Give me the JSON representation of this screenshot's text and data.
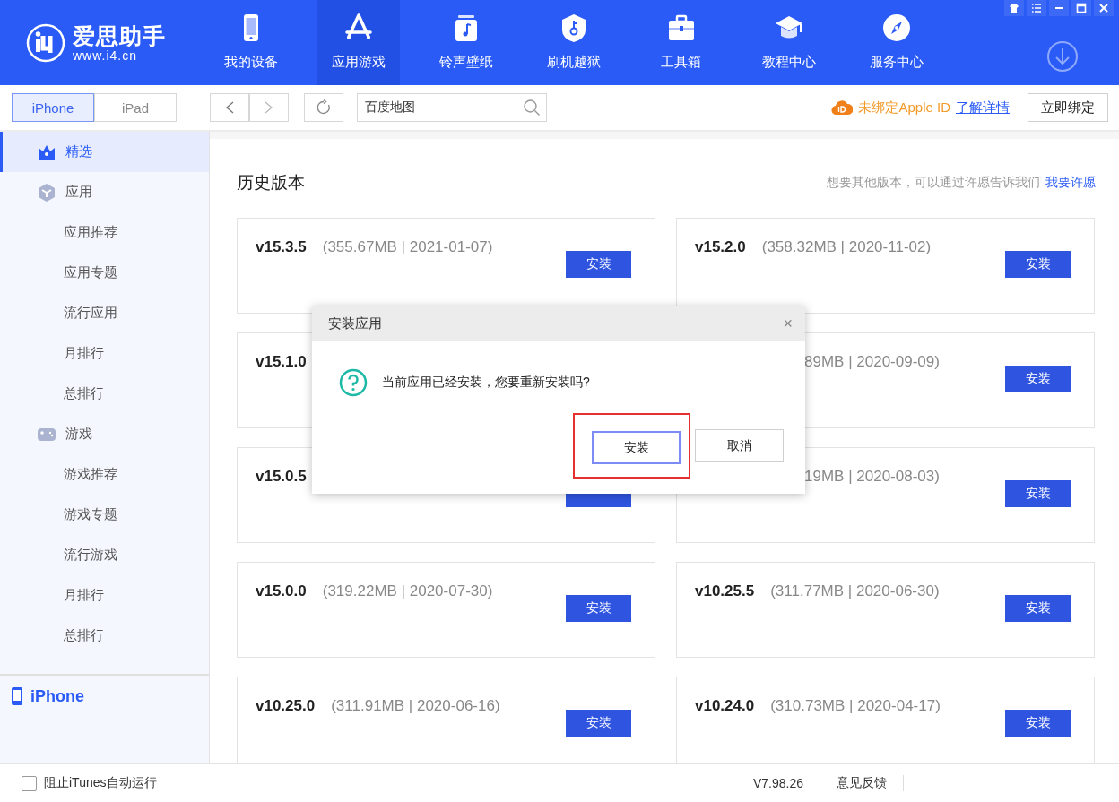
{
  "logo": {
    "name": "爱思助手",
    "url": "www.i4.cn"
  },
  "nav": [
    {
      "label": "我的设备",
      "selected": false
    },
    {
      "label": "应用游戏",
      "selected": true
    },
    {
      "label": "铃声壁纸",
      "selected": false
    },
    {
      "label": "刷机越狱",
      "selected": false
    },
    {
      "label": "工具箱",
      "selected": false
    },
    {
      "label": "教程中心",
      "selected": false
    },
    {
      "label": "服务中心",
      "selected": false
    }
  ],
  "device_tabs": [
    {
      "label": "iPhone",
      "selected": true
    },
    {
      "label": "iPad",
      "selected": false
    }
  ],
  "search": {
    "value": "百度地图"
  },
  "apple_id": {
    "status": "未绑定Apple ID",
    "link": "了解详情",
    "button": "立即绑定"
  },
  "sidebar": {
    "items": [
      {
        "label": "精选",
        "selected": true
      },
      {
        "label": "应用",
        "selected": false,
        "children": [
          {
            "label": "应用推荐",
            "selected": false
          },
          {
            "label": "应用专题",
            "selected": false
          },
          {
            "label": "流行应用",
            "selected": false
          },
          {
            "label": "月排行",
            "selected": false
          },
          {
            "label": "总排行",
            "selected": false
          }
        ]
      },
      {
        "label": "游戏",
        "selected": false,
        "children": [
          {
            "label": "游戏推荐",
            "selected": false
          },
          {
            "label": "游戏专题",
            "selected": false
          },
          {
            "label": "流行游戏",
            "selected": false
          },
          {
            "label": "月排行",
            "selected": false
          },
          {
            "label": "总排行",
            "selected": false
          }
        ]
      }
    ],
    "device": "iPhone"
  },
  "main": {
    "title": "历史版本",
    "hint": "想要其他版本，可以通过许愿告诉我们",
    "hint_link": "我要许愿",
    "versions": [
      {
        "version": "v15.3.5",
        "detail": "(355.67MB | 2021-01-07)",
        "button": "安装"
      },
      {
        "version": "v15.2.0",
        "detail": "(358.32MB | 2020-11-02)",
        "button": "安装"
      },
      {
        "version": "v15.1.0"
      },
      {
        "detail": "89MB | 2020-09-09)",
        "button": "安装"
      },
      {
        "version": "v15.0.5",
        "button_covered": true
      },
      {
        "detail": "19MB | 2020-08-03)",
        "button": "安装"
      },
      {
        "version": "v15.0.0",
        "detail": "(319.22MB | 2020-07-30)",
        "button": "安装"
      },
      {
        "version": "v10.25.5",
        "detail": "(311.77MB | 2020-06-30)",
        "button": "安装"
      },
      {
        "version": "v10.25.0",
        "detail": "(311.91MB | 2020-06-16)",
        "button": "安装"
      },
      {
        "version": "v10.24.0",
        "detail": "(310.73MB | 2020-04-17)",
        "button": "安装"
      }
    ]
  },
  "dialog": {
    "title": "安装应用",
    "close": "×",
    "message": "当前应用已经安装，您要重新安装吗?",
    "buttons": [
      {
        "label": "安装",
        "kind": "primary",
        "highlighted": true
      },
      {
        "label": "取消",
        "kind": "secondary",
        "highlighted": false
      }
    ]
  },
  "footer": {
    "checkbox": {
      "label": "阻止iTunes自动运行",
      "checked": false
    },
    "version": "V7.98.26",
    "feedback": "意见反馈"
  }
}
